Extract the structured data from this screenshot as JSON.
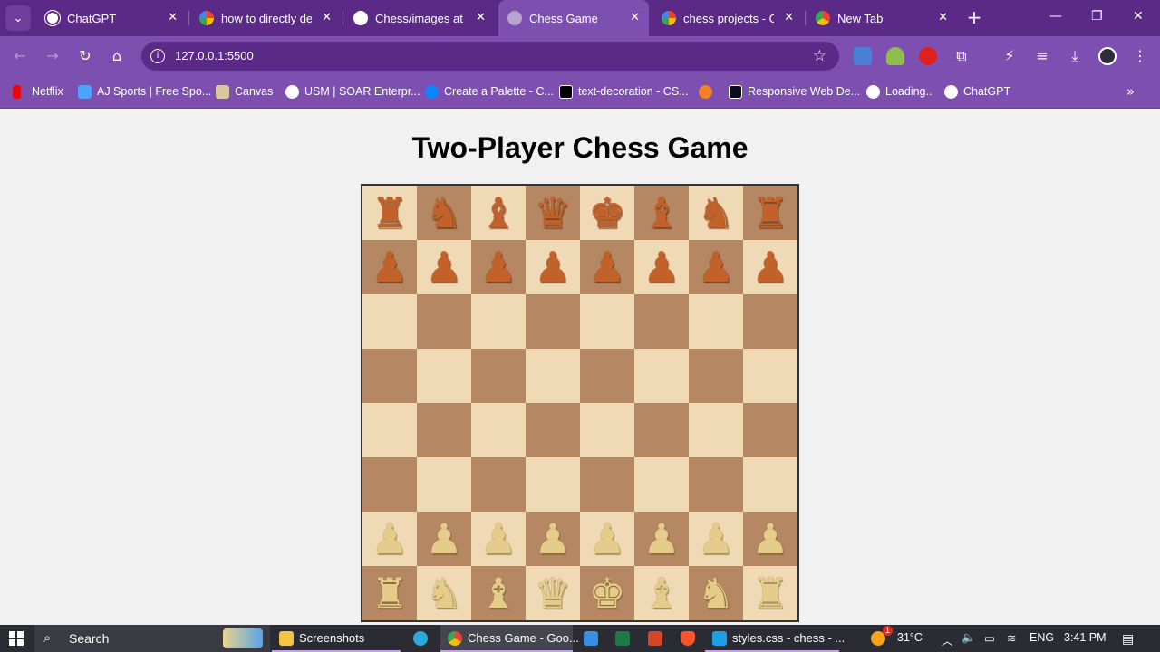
{
  "browser": {
    "tabs": [
      {
        "title": "ChatGPT",
        "favicon": "chatgpt-icon",
        "active": false
      },
      {
        "title": "how to directly dep",
        "favicon": "google-icon",
        "active": false
      },
      {
        "title": "Chess/images at m",
        "favicon": "github-icon",
        "active": false
      },
      {
        "title": "Chess Game",
        "favicon": "globe-icon",
        "active": true
      },
      {
        "title": "chess projects - Go",
        "favicon": "google-icon",
        "active": false
      },
      {
        "title": "New Tab",
        "favicon": "chrome-icon",
        "active": false
      }
    ],
    "url": "127.0.0.1:5500",
    "bookmarks": [
      {
        "label": "Netflix",
        "icon": "netflix-icon",
        "color": "#e50914"
      },
      {
        "label": "AJ Sports | Free Spo...",
        "icon": "ajsports-icon",
        "color": "#4aa3ff"
      },
      {
        "label": "Canvas",
        "icon": "canvas-icon",
        "color": "#d9c7a0"
      },
      {
        "label": "USM | SOAR Enterpr...",
        "icon": "globe-icon",
        "color": "#ffffff"
      },
      {
        "label": "Create a Palette - C...",
        "icon": "coolors-icon",
        "color": "#0a84ff"
      },
      {
        "label": "text-decoration - CS...",
        "icon": "mdn-icon",
        "color": "#000000"
      },
      {
        "label": "",
        "icon": "gear-orange-icon",
        "color": "#f58220"
      },
      {
        "label": "Responsive Web De...",
        "icon": "freecodecamp-icon",
        "color": "#0a0a23"
      },
      {
        "label": "Loading..",
        "icon": "globe-icon",
        "color": "#ffffff"
      },
      {
        "label": "ChatGPT",
        "icon": "chatgpt-icon",
        "color": "#ffffff"
      }
    ]
  },
  "page": {
    "title": "Two-Player Chess Game",
    "board": [
      [
        "br",
        "bn",
        "bb",
        "bq",
        "bk",
        "bb",
        "bn",
        "br"
      ],
      [
        "bp",
        "bp",
        "bp",
        "bp",
        "bp",
        "bp",
        "bp",
        "bp"
      ],
      [
        "",
        "",
        "",
        "",
        "",
        "",
        "",
        ""
      ],
      [
        "",
        "",
        "",
        "",
        "",
        "",
        "",
        ""
      ],
      [
        "",
        "",
        "",
        "",
        "",
        "",
        "",
        ""
      ],
      [
        "",
        "",
        "",
        "",
        "",
        "",
        "",
        ""
      ],
      [
        "wp",
        "wp",
        "wp",
        "wp",
        "wp",
        "wp",
        "wp",
        "wp"
      ],
      [
        "wr",
        "wn",
        "wb",
        "wq",
        "wk",
        "wb",
        "wn",
        "wr"
      ]
    ],
    "colors": {
      "light_square": "#f0d9b5",
      "dark_square": "#b58863",
      "black_piece": "#c2622a",
      "white_piece": "#e6cc8a"
    }
  },
  "taskbar": {
    "search_label": "Search",
    "apps": [
      {
        "label": "Screenshots",
        "icon": "folder-icon",
        "color": "#f5c542"
      },
      {
        "label": "",
        "icon": "edge-icon",
        "color": "#2aa9e0"
      },
      {
        "label": "Chess Game - Goo...",
        "icon": "chrome-icon",
        "color": "#4285f4"
      },
      {
        "label": "",
        "icon": "mail-icon",
        "color": "#3b8fe0"
      },
      {
        "label": "",
        "icon": "excel-icon",
        "color": "#1d7a45"
      },
      {
        "label": "",
        "icon": "powerpoint-icon",
        "color": "#d24726"
      },
      {
        "label": "",
        "icon": "brave-icon",
        "color": "#fb542b"
      },
      {
        "label": "styles.css - chess - ...",
        "icon": "vscode-icon",
        "color": "#1e9de8"
      }
    ],
    "weather": "31°C",
    "weather_badge": "1",
    "language": "ENG",
    "time": "3:41 PM"
  }
}
